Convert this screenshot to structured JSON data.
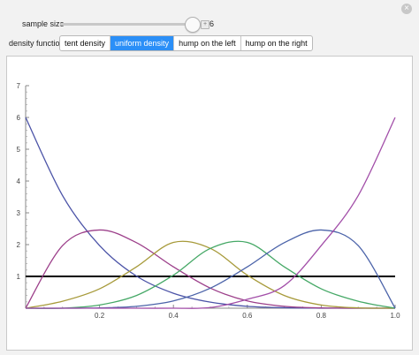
{
  "controls": {
    "sample_size_label": "sample size",
    "sample_size_value": "6",
    "sample_size_fraction": 0.94,
    "plus_icon": "plus-icon",
    "density_label": "density function",
    "density_options": [
      "tent density",
      "uniform density",
      "hump on the left",
      "hump on the right"
    ],
    "selected_option": "uniform density"
  },
  "colors": {
    "series": [
      "#4b53a7",
      "#9c3f8a",
      "#a79a3a",
      "#45a866",
      "#4b63a9",
      "#a24ea8"
    ],
    "density": "#000000",
    "selected_tab": "#2b8ff7"
  },
  "chart_data": {
    "type": "line",
    "title": "",
    "xlabel": "",
    "ylabel": "",
    "xlim": [
      0,
      1.0
    ],
    "ylim": [
      0,
      7
    ],
    "xticks": [
      "0.2",
      "0.4",
      "0.6",
      "0.8",
      "1.0"
    ],
    "yticks": [
      "1",
      "2",
      "3",
      "4",
      "5",
      "6",
      "7"
    ],
    "x": [
      0,
      0.1,
      0.2,
      0.3,
      0.4,
      0.5,
      0.6,
      0.7,
      0.8,
      0.9,
      1.0
    ],
    "series": [
      {
        "values": [
          6.0,
          3.54,
          1.97,
          1.01,
          0.47,
          0.19,
          0.06,
          0.015,
          0.002,
          0.0,
          0.0
        ]
      },
      {
        "values": [
          0.0,
          1.97,
          2.46,
          2.06,
          1.3,
          0.63,
          0.23,
          0.06,
          0.01,
          0.0,
          0.0
        ]
      },
      {
        "values": [
          0.0,
          0.22,
          0.61,
          1.3,
          2.07,
          1.88,
          1.04,
          0.4,
          0.1,
          0.01,
          0.0
        ]
      },
      {
        "values": [
          0.0,
          0.0,
          0.1,
          0.4,
          1.04,
          1.88,
          2.07,
          1.3,
          0.61,
          0.22,
          0.0
        ]
      },
      {
        "values": [
          0.0,
          0.0,
          0.01,
          0.06,
          0.23,
          0.63,
          1.3,
          2.06,
          2.46,
          1.97,
          0.0
        ]
      },
      {
        "values": [
          0.0,
          0.0,
          0.0,
          0.0,
          0.0,
          0.02,
          0.28,
          0.71,
          1.97,
          3.54,
          6.0
        ]
      }
    ],
    "density_line": {
      "values": [
        1,
        1
      ]
    }
  }
}
